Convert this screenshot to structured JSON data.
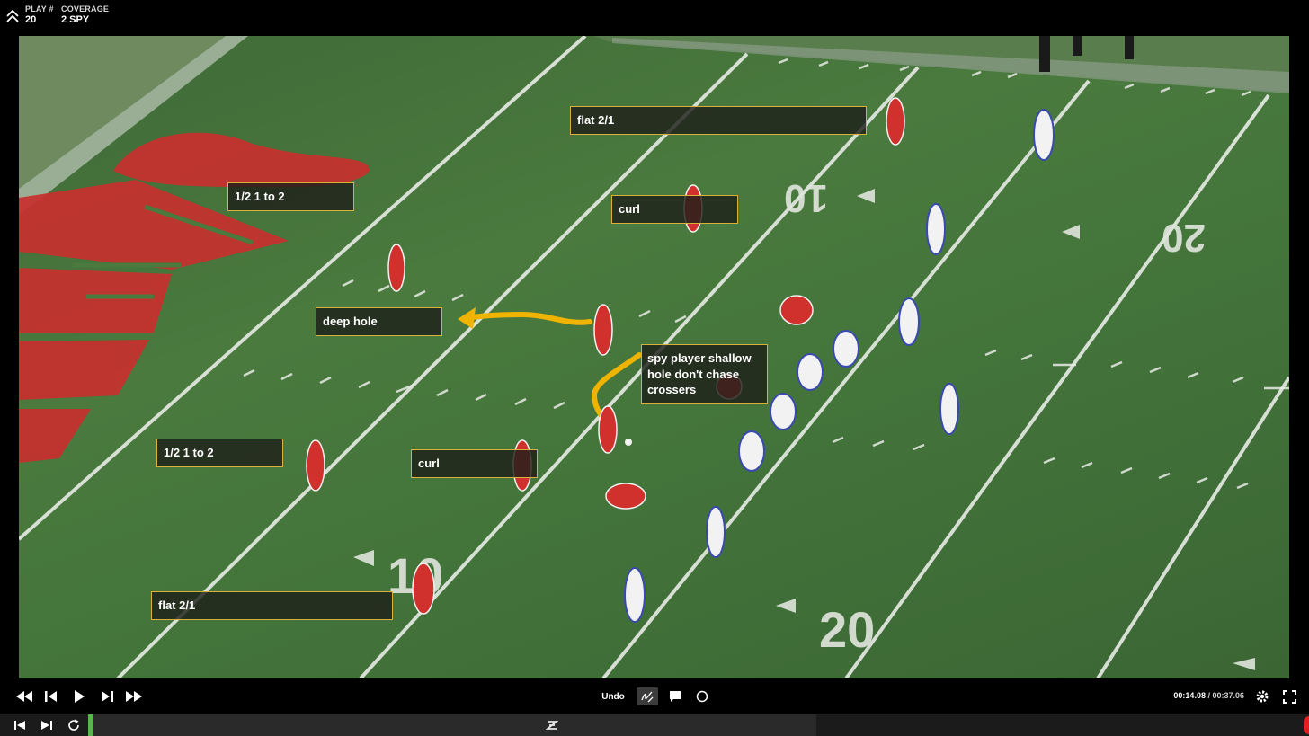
{
  "play": {
    "label": "PLAY #",
    "value": "20"
  },
  "coverage": {
    "label": "COVERAGE",
    "value": "2 SPY"
  },
  "yard_numbers": [
    "10",
    "20",
    "10",
    "20"
  ],
  "annotations": [
    {
      "id": "flat-top",
      "text": "flat 2/1"
    },
    {
      "id": "half-top",
      "text": "1/2 1 to 2"
    },
    {
      "id": "curl-top",
      "text": "curl"
    },
    {
      "id": "deep-hole",
      "text": "deep hole"
    },
    {
      "id": "spy",
      "text": "spy player shallow hole don't chase crossers"
    },
    {
      "id": "half-bottom",
      "text": "1/2 1 to 2"
    },
    {
      "id": "curl-bottom",
      "text": "curl"
    },
    {
      "id": "flat-bottom",
      "text": "flat 2/1"
    }
  ],
  "controls": {
    "undo_label": "Undo",
    "time_current": "00:14.08",
    "time_separator": " / ",
    "time_total": "00:37.06",
    "icons": [
      "rewind-icon",
      "step-back-icon",
      "play-icon",
      "step-forward-icon",
      "fast-forward-icon",
      "draw-icon",
      "comment-icon",
      "circle-icon",
      "settings-icon",
      "fullscreen-icon"
    ]
  },
  "playback": {
    "progress_fraction": 0.008
  },
  "colors": {
    "field_green": "#4a7a3e",
    "endzone_red": "#c8302e",
    "annotation_border": "#d8b23a",
    "route_yellow": "#f0b400",
    "progress_green": "#57b84a",
    "home_red": "#d0312d",
    "away_white": "#f2f2f2",
    "away_blue": "#3a49b0"
  }
}
